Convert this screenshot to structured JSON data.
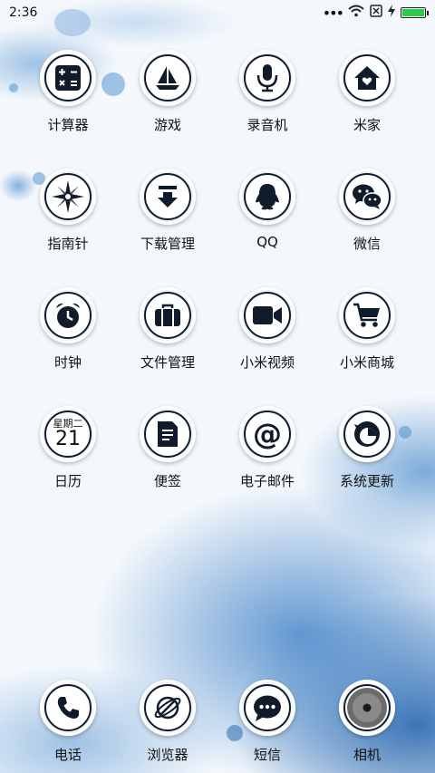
{
  "status": {
    "time": "2:36",
    "signal_icon": "dots-icon",
    "wifi_icon": "wifi-icon",
    "sim_icon": "sim-off-icon",
    "charging_icon": "charging-icon",
    "battery_level": 1.0,
    "battery_color": "#2dc84d"
  },
  "apps": [
    {
      "label": "计算器",
      "icon": "calculator-icon"
    },
    {
      "label": "游戏",
      "icon": "sailboat-icon"
    },
    {
      "label": "录音机",
      "icon": "microphone-icon"
    },
    {
      "label": "米家",
      "icon": "home-heart-icon"
    },
    {
      "label": "指南针",
      "icon": "compass-icon"
    },
    {
      "label": "下载管理",
      "icon": "download-icon"
    },
    {
      "label": "QQ",
      "icon": "penguin-icon"
    },
    {
      "label": "微信",
      "icon": "wechat-icon"
    },
    {
      "label": "时钟",
      "icon": "alarm-clock-icon"
    },
    {
      "label": "文件管理",
      "icon": "briefcase-icon"
    },
    {
      "label": "小米视频",
      "icon": "video-camera-icon"
    },
    {
      "label": "小米商城",
      "icon": "shopping-cart-icon"
    },
    {
      "label": "日历",
      "icon": "calendar-icon",
      "weekday": "星期二",
      "date": "21"
    },
    {
      "label": "便签",
      "icon": "note-icon"
    },
    {
      "label": "电子邮件",
      "icon": "at-sign-icon"
    },
    {
      "label": "系统更新",
      "icon": "update-icon"
    }
  ],
  "dock": [
    {
      "label": "电话",
      "icon": "phone-icon"
    },
    {
      "label": "浏览器",
      "icon": "browser-globe-icon"
    },
    {
      "label": "短信",
      "icon": "message-bubble-icon"
    },
    {
      "label": "相机",
      "icon": "camera-lens-icon"
    }
  ],
  "colors": {
    "icon_ink": "#101c2c",
    "wallpaper_blue": "#3a7fc4"
  }
}
